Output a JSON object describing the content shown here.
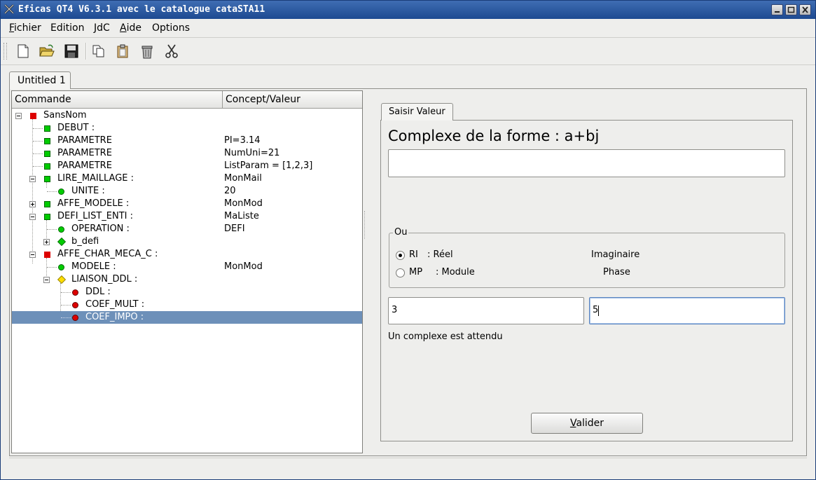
{
  "window": {
    "title": "Eficas QT4 V6.3.1 avec le catalogue cataSTA11"
  },
  "menubar": {
    "fichier": "Fichier",
    "edition": "Edition",
    "jdc": "JdC",
    "aide": "Aide",
    "options": "Options"
  },
  "toolbar": {
    "icons": [
      "new-file-icon",
      "open-folder-icon",
      "save-icon",
      "copy-icon",
      "paste-icon",
      "delete-icon",
      "cut-icon"
    ]
  },
  "document_tab": {
    "label": "Untitled 1"
  },
  "tree": {
    "headers": {
      "command": "Commande",
      "value": "Concept/Valeur"
    },
    "rows": [
      {
        "label": "SansNom",
        "value": ""
      },
      {
        "label": "DEBUT :",
        "value": ""
      },
      {
        "label": "PARAMETRE",
        "value": "PI=3.14"
      },
      {
        "label": "PARAMETRE",
        "value": "NumUni=21"
      },
      {
        "label": "PARAMETRE",
        "value": "ListParam = [1,2,3]"
      },
      {
        "label": "LIRE_MAILLAGE :",
        "value": "MonMail"
      },
      {
        "label": "UNITE :",
        "value": "20"
      },
      {
        "label": "AFFE_MODELE :",
        "value": "MonMod"
      },
      {
        "label": "DEFI_LIST_ENTI :",
        "value": "MaListe"
      },
      {
        "label": "OPERATION :",
        "value": "DEFI"
      },
      {
        "label": "b_defi",
        "value": ""
      },
      {
        "label": "AFFE_CHAR_MECA_C :",
        "value": ""
      },
      {
        "label": "MODELE :",
        "value": "MonMod"
      },
      {
        "label": "LIAISON_DDL :",
        "value": ""
      },
      {
        "label": "DDL :",
        "value": ""
      },
      {
        "label": "COEF_MULT :",
        "value": ""
      },
      {
        "label": "COEF_IMPO :",
        "value": ""
      }
    ],
    "colors": {
      "valid": "#00cc00",
      "invalid": "#dd0000",
      "warning": "#ffdd00",
      "selection": "#6d90b9"
    }
  },
  "panel": {
    "tab_label": "Saisir Valeur",
    "heading": "Complexe de la forme : a+bj",
    "complex_input": {
      "value": ""
    },
    "group_title": "Ou",
    "ri": {
      "code": "RI",
      "desc": ": Réel",
      "second": "Imaginaire",
      "checked": true
    },
    "mp": {
      "code": "MP",
      "desc": ": Module",
      "second": "Phase",
      "checked": false
    },
    "real_value": "3",
    "imag_value": "5",
    "message": "Un complexe est attendu",
    "validate_label": "Valider"
  }
}
